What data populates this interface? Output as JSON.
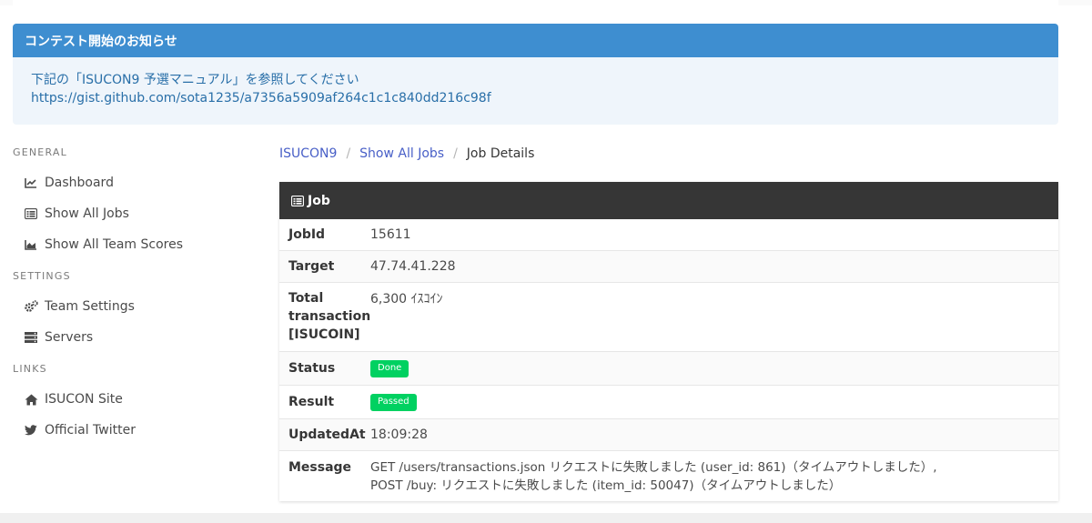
{
  "notice": {
    "title": "コンテスト開始のお知らせ",
    "line1": "下記の「ISUCON9 予選マニュアル」を参照してください",
    "line2": "https://gist.github.com/sota1235/a7356a5909af264c1c1c840dd216c98f"
  },
  "sidebar": {
    "sections": [
      {
        "label": "GENERAL",
        "items": [
          {
            "label": "Dashboard",
            "icon": "chart-line-icon"
          },
          {
            "label": "Show All Jobs",
            "icon": "list-icon"
          },
          {
            "label": "Show All Team Scores",
            "icon": "chart-area-icon"
          }
        ]
      },
      {
        "label": "SETTINGS",
        "items": [
          {
            "label": "Team Settings",
            "icon": "cogs-icon"
          },
          {
            "label": "Servers",
            "icon": "server-icon"
          }
        ]
      },
      {
        "label": "LINKS",
        "items": [
          {
            "label": "ISUCON Site",
            "icon": "home-icon"
          },
          {
            "label": "Official Twitter",
            "icon": "twitter-icon"
          }
        ]
      }
    ]
  },
  "breadcrumb": {
    "items": [
      "ISUCON9",
      "Show All Jobs",
      "Job Details"
    ],
    "separator": "/"
  },
  "job": {
    "title": "Job",
    "rows": {
      "jobid": {
        "key": "JobId",
        "value": "15611"
      },
      "target": {
        "key": "Target",
        "value": "47.74.41.228"
      },
      "total": {
        "key": "Total transaction [ISUCOIN]",
        "value": "6,300 ｲｽｺｲﾝ"
      },
      "status": {
        "key": "Status",
        "value": "Done"
      },
      "result": {
        "key": "Result",
        "value": "Passed"
      },
      "updated": {
        "key": "UpdatedAt",
        "value": "18:09:28"
      },
      "message": {
        "key": "Message",
        "line1": "GET /users/transactions.json リクエストに失敗しました (user_id: 861)（タイムアウトしました）,",
        "line2": "POST /buy: リクエストに失敗しました (item_id: 50047)（タイムアウトしました）"
      }
    }
  },
  "colors": {
    "notice_header": "#3e8ed0",
    "notice_body": "#eff5fb",
    "card_header": "#363636",
    "success": "#00d161",
    "link": "#485fc7"
  }
}
